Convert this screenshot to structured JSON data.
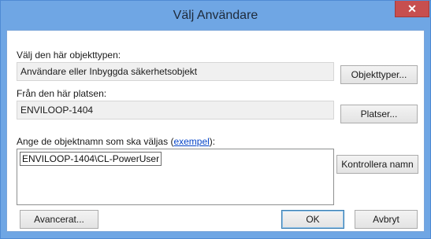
{
  "window": {
    "title": "Välj Användare",
    "close_label": "✕"
  },
  "object_type": {
    "label": "Välj den här objekttypen:",
    "value": "Användare eller Inbyggda säkerhetsobjekt",
    "button": "Objekttyper..."
  },
  "location": {
    "label": "Från den här platsen:",
    "value": "ENVILOOP-1404",
    "button": "Platser..."
  },
  "names": {
    "label_before": "Ange de objektnamn som ska väljas (",
    "label_link": "exempel",
    "label_after": "):",
    "value": "ENVILOOP-1404\\CL-PowerUser",
    "check_button": "Kontrollera namn"
  },
  "footer": {
    "advanced_button": "Avancerat...",
    "ok_button": "OK",
    "cancel_button": "Avbryt"
  }
}
